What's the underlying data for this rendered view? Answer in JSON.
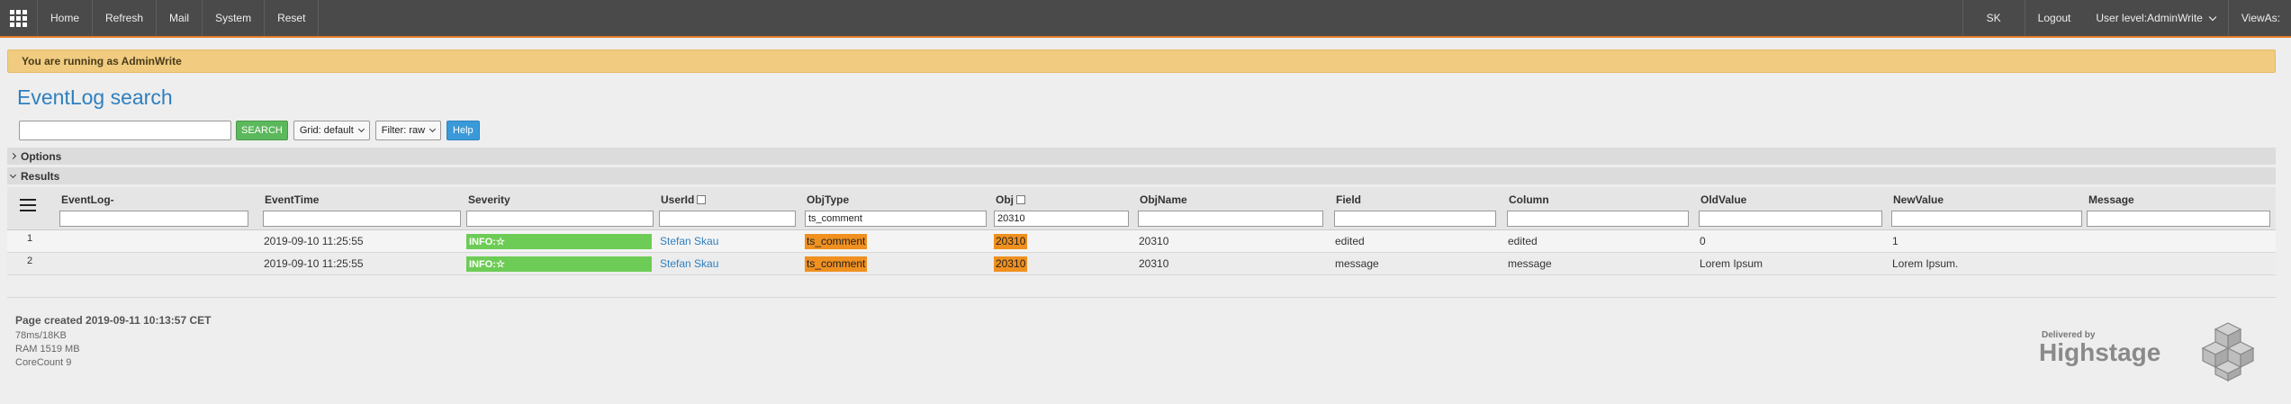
{
  "nav": {
    "items": [
      "Home",
      "Refresh",
      "Mail",
      "System",
      "Reset"
    ],
    "user_initials": "SK",
    "logout": "Logout",
    "user_level": "User level:AdminWrite",
    "view_as": "ViewAs:"
  },
  "banner": {
    "text": "You are running as AdminWrite"
  },
  "page": {
    "title": "EventLog search"
  },
  "search": {
    "value": "",
    "button": "SEARCH",
    "grid_select": "Grid: default",
    "filter_select": "Filter: raw",
    "help": "Help"
  },
  "sections": {
    "options": "Options",
    "results": "Results"
  },
  "table": {
    "columns": [
      "EventLog-",
      "EventTime",
      "Severity",
      "UserId",
      "ObjType",
      "Obj",
      "ObjName",
      "Field",
      "Column",
      "OldValue",
      "NewValue",
      "Message"
    ],
    "filters": {
      "objtype": "ts_comment",
      "obj": "20310"
    },
    "rows": [
      {
        "num": "1",
        "time": "2019-09-10 11:25:55",
        "severity": "INFO:☆",
        "user": "Stefan Skau",
        "objtype": "ts_comment",
        "obj": "20310",
        "objname": "20310",
        "field": "edited",
        "column": "edited",
        "old": "0",
        "new": "1",
        "message": ""
      },
      {
        "num": "2",
        "time": "2019-09-10 11:25:55",
        "severity": "INFO:☆",
        "user": "Stefan Skau",
        "objtype": "ts_comment",
        "obj": "20310",
        "objname": "20310",
        "field": "message",
        "column": "message",
        "old": "Lorem Ipsum",
        "new": "Lorem Ipsum.",
        "message": ""
      }
    ]
  },
  "footer": {
    "created": "Page created 2019-09-11 10:13:57 CET",
    "timing": "78ms/18KB",
    "ram": "RAM 1519 MB",
    "cores": "CoreCount 9"
  },
  "brand": {
    "delivered_by": "Delivered by",
    "name": "Highstage"
  },
  "colors": {
    "accent_orange": "#e07b2a",
    "banner": "#f0cb80",
    "success": "#5cb85c",
    "link": "#2f7fbf",
    "info_tag": "#6dcc55",
    "highlight": "#f0901f"
  }
}
